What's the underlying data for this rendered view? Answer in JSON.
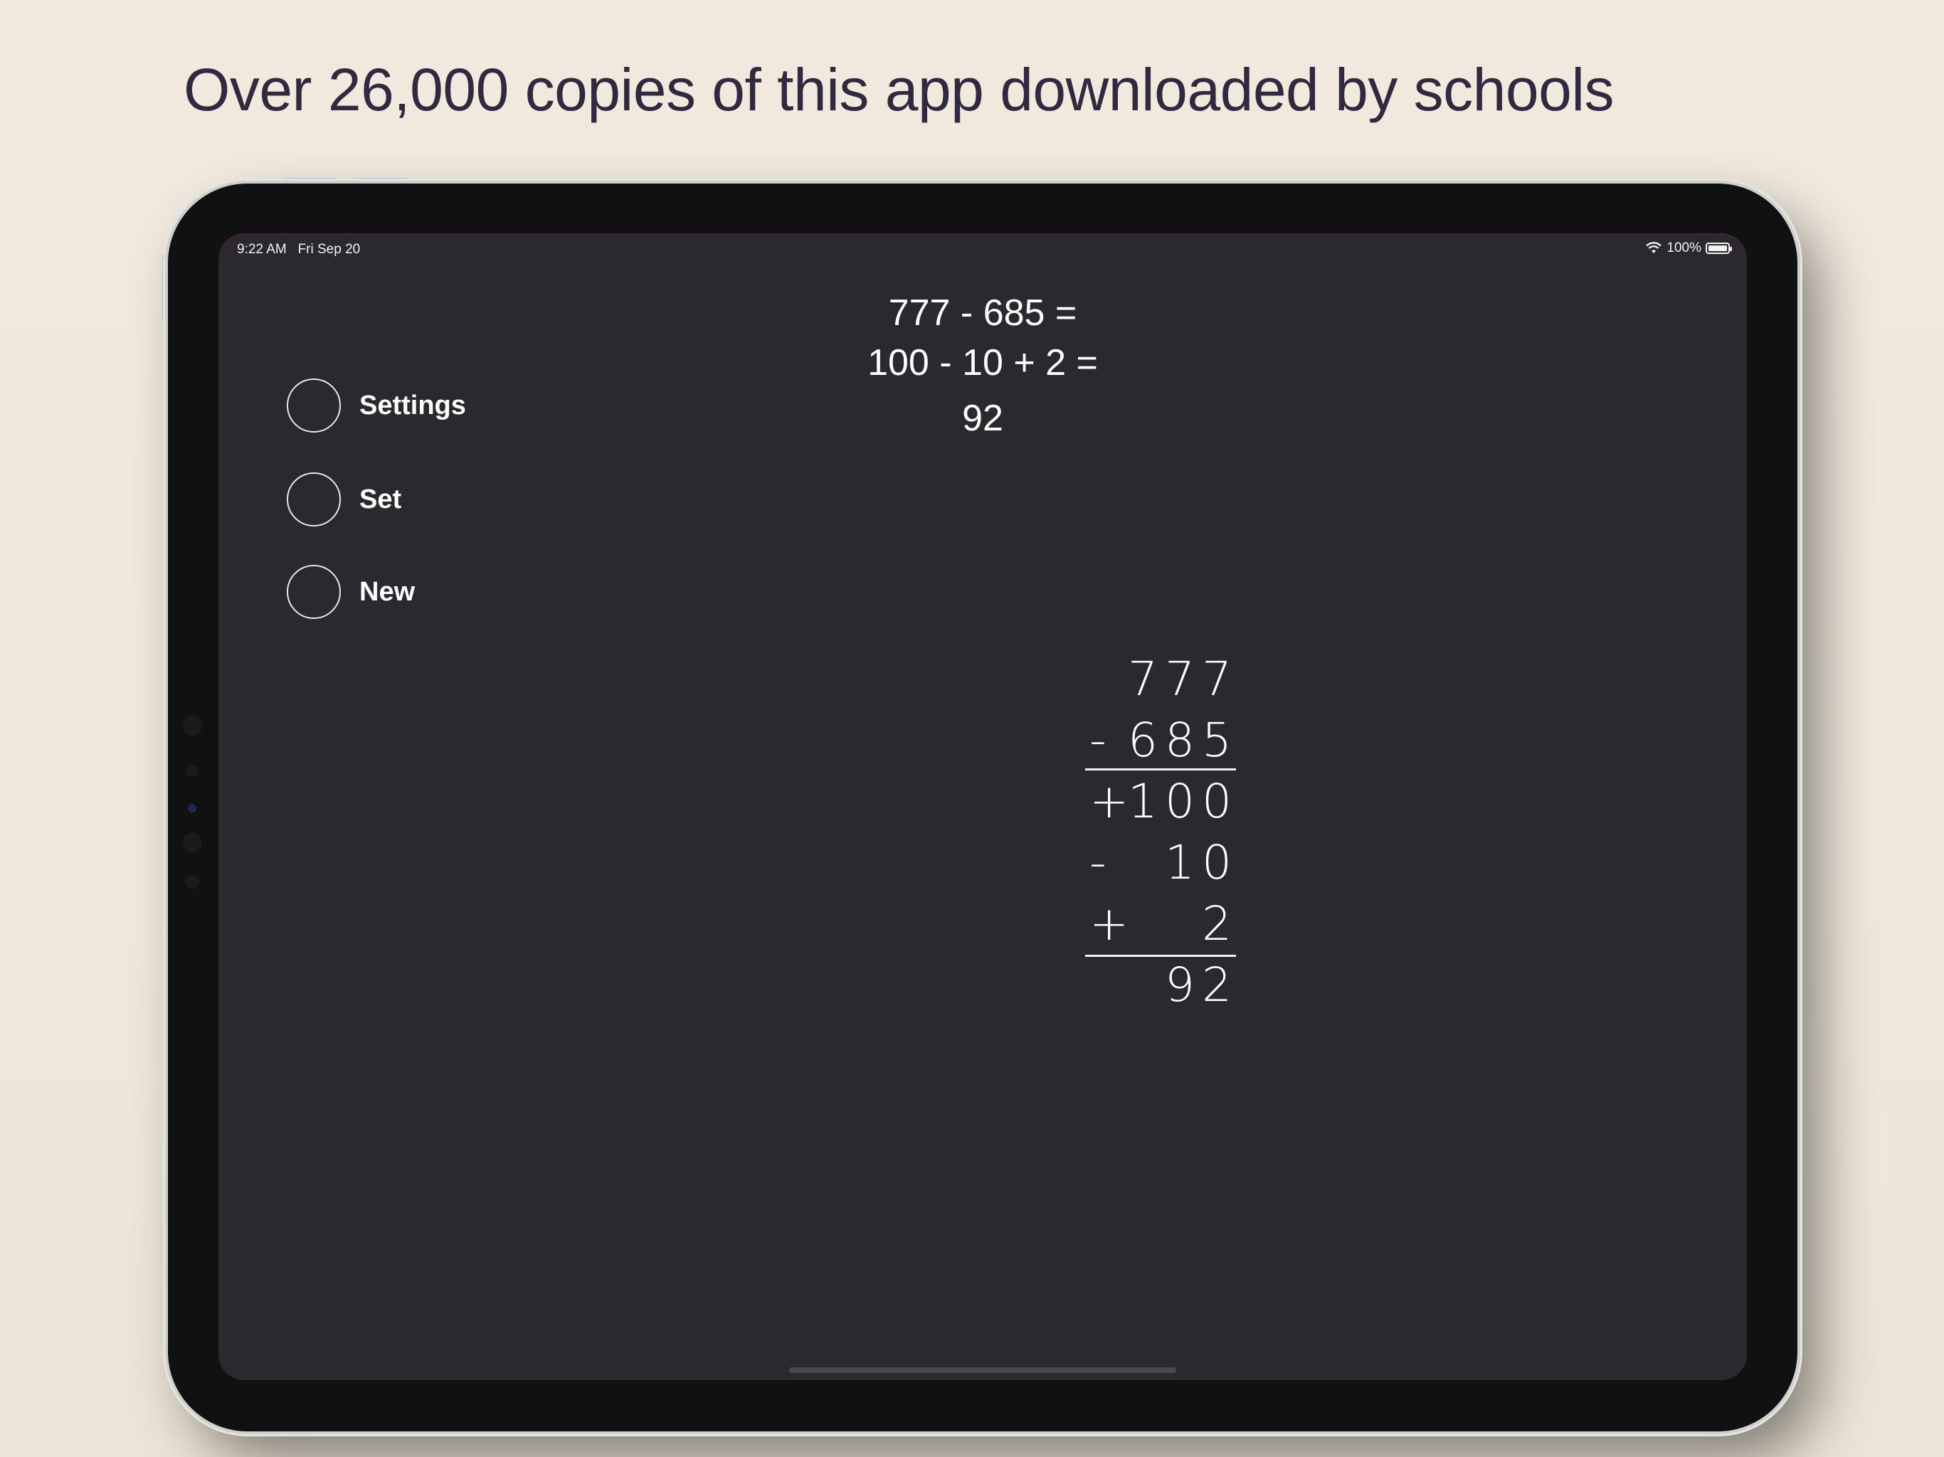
{
  "headline": "Over 26,000 copies of this app downloaded by schools",
  "status_bar": {
    "time": "9:22 AM",
    "date": "Fri Sep 20",
    "battery": "100%"
  },
  "equation": {
    "line1": "777 - 685 =",
    "line2": "100 - 10 + 2 =",
    "result": "92"
  },
  "menu": [
    {
      "label": "Settings"
    },
    {
      "label": "Set"
    },
    {
      "label": "New"
    }
  ],
  "column": {
    "rows": [
      {
        "op": "",
        "digits": "777"
      },
      {
        "op": "-",
        "digits": "685"
      },
      {
        "op": "+",
        "digits": "100"
      },
      {
        "op": "-",
        "digits": "10"
      },
      {
        "op": "+",
        "digits": "2"
      },
      {
        "op": "",
        "digits": "92"
      }
    ]
  },
  "colors": {
    "background": "#efe8dc",
    "headline": "#2f2a40",
    "screen": "#2b282e",
    "text": "#ffffff"
  }
}
